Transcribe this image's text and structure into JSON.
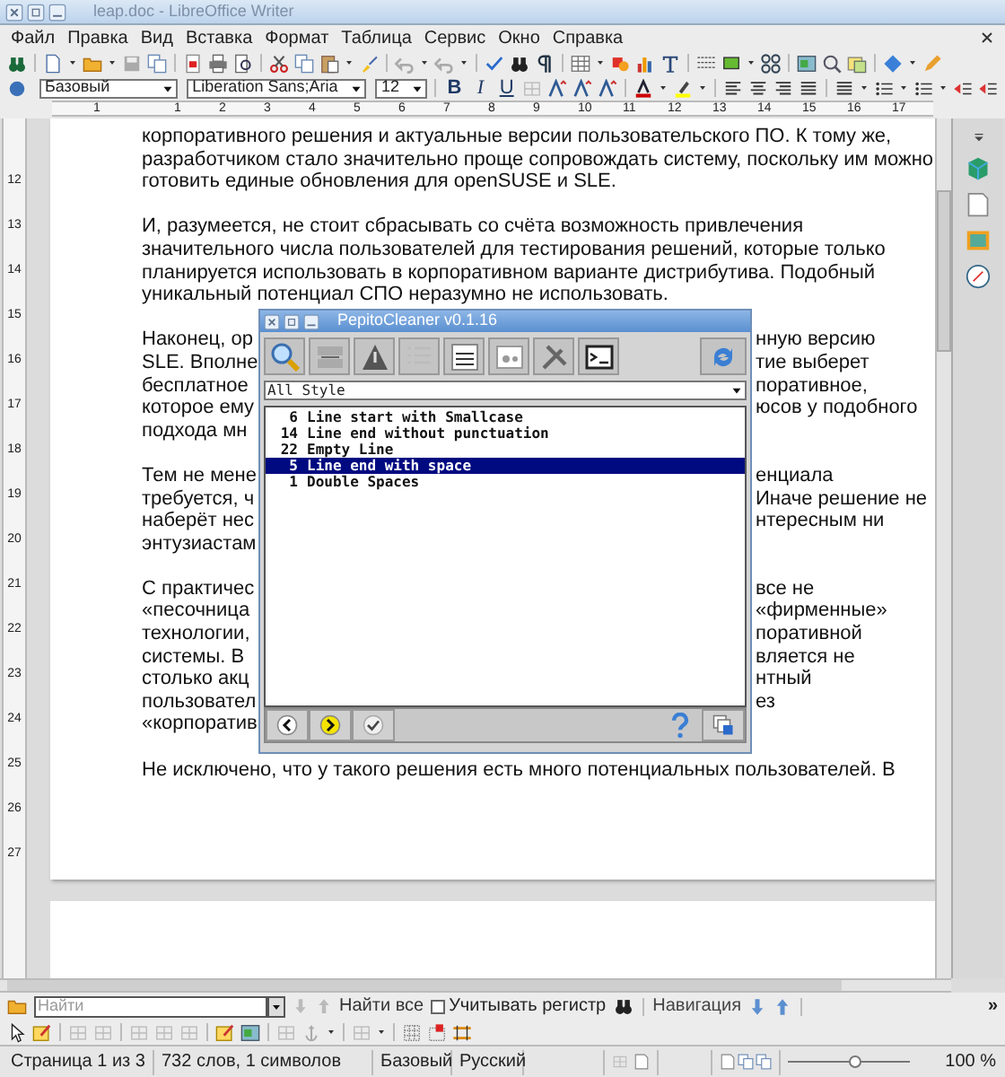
{
  "window": {
    "title": "leap.doc - LibreOffice Writer"
  },
  "menu": [
    {
      "label": "Файл"
    },
    {
      "label": "Правка"
    },
    {
      "label": "Вид"
    },
    {
      "label": "Вставка"
    },
    {
      "label": "Формат"
    },
    {
      "label": "Таблица"
    },
    {
      "label": "Сервис"
    },
    {
      "label": "Окно"
    },
    {
      "label": "Справка"
    }
  ],
  "formatting": {
    "paragraph_style": "Базовый",
    "font_name": "Liberation Sans;Aria",
    "font_size": "12",
    "buttons": [
      {
        "label": "B",
        "kind": "bold"
      },
      {
        "label": "I",
        "kind": "italic"
      },
      {
        "label": "U",
        "kind": "underline"
      }
    ]
  },
  "ruler": {
    "numbers": [
      "1",
      "1",
      "2",
      "3",
      "4",
      "5",
      "6",
      "7",
      "8",
      "9",
      "10",
      "11",
      "12",
      "13",
      "14",
      "15",
      "16",
      "17"
    ]
  },
  "vertical_ruler": {
    "numbers": [
      "12",
      "13",
      "14",
      "15",
      "16",
      "17",
      "18",
      "19",
      "20",
      "21",
      "22",
      "23",
      "24",
      "25",
      "26",
      "27"
    ]
  },
  "document": {
    "paragraphs": [
      {
        "lines": [
          {
            "text": "корпоративного решения и актуальные версии пользовательского ПО. К тому же,"
          },
          {
            "text": "разработчиком стало значительно проще сопровождать систему, поскольку им можно"
          },
          {
            "text": "готовить единые обновления для openSUSE и SLE."
          }
        ]
      },
      {
        "lines": [
          {
            "text": "И, разумеется, не стоит сбрасывать со счёта возможность привлечения"
          },
          {
            "text": "значительного числа пользователей для тестирования решений, которые только"
          },
          {
            "text": "планируется использовать в корпоративном варианте дистрибутива. Подобный"
          },
          {
            "text": "уникальный потенциал СПО неразумно не использовать."
          }
        ]
      },
      {
        "lines": [
          {
            "left": "Наконец, ор",
            "right": "нную версию"
          },
          {
            "left": "SLE. Вполне",
            "right": "тие выберет"
          },
          {
            "left": "бесплатное",
            "right": "поративное,"
          },
          {
            "left": "которое ему",
            "right": "юсов у подобного"
          },
          {
            "left": "подхода мн"
          }
        ]
      },
      {
        "lines": [
          {
            "left": "Тем не мене",
            "right": "енциала"
          },
          {
            "left": "требуется, ч",
            "right": "Иначе решение не"
          },
          {
            "left": "наберёт нес",
            "right": "нтересным ни"
          },
          {
            "left": "энтузиастам"
          }
        ]
      },
      {
        "lines": [
          {
            "left": "С практичес",
            "right": "все не"
          },
          {
            "left": "«песочница",
            "right": "«фирменные»"
          },
          {
            "left": "технологии,",
            "right": "поративной"
          },
          {
            "left": "системы. В",
            "right": "вляется не"
          },
          {
            "left": "столько акц",
            "right": "нтный"
          },
          {
            "left": "пользовател",
            "right": "ез"
          },
          {
            "left": "«корпоратив"
          }
        ]
      },
      {
        "lines": [
          {
            "text": "Не исключено, что у такого решения есть много потенциальных пользователей. В"
          }
        ]
      }
    ]
  },
  "dialog": {
    "title": "PepitoCleaner v0.1.16",
    "filter": "All Style",
    "items": [
      {
        "count": "6",
        "label": "Line start with Smallcase",
        "selected": false
      },
      {
        "count": "14",
        "label": "Line end without punctuation",
        "selected": false
      },
      {
        "count": "22",
        "label": "Empty Line",
        "selected": false
      },
      {
        "count": "5",
        "label": "Line end with space",
        "selected": true
      },
      {
        "count": "1",
        "label": "Double Spaces",
        "selected": false
      }
    ]
  },
  "find_bar": {
    "placeholder": "Найти",
    "find_all": "Найти все",
    "match_case": {
      "label": "Учитывать регистр",
      "checked": false
    },
    "navigation": "Навигация",
    "more": "»"
  },
  "status_bar": {
    "page": "Страница 1 из 3",
    "words": "732 слов, 1 символов",
    "style": "Базовый",
    "language": "Русский",
    "zoom_slider": {
      "level": 0.55
    },
    "zoom": "100 %"
  }
}
